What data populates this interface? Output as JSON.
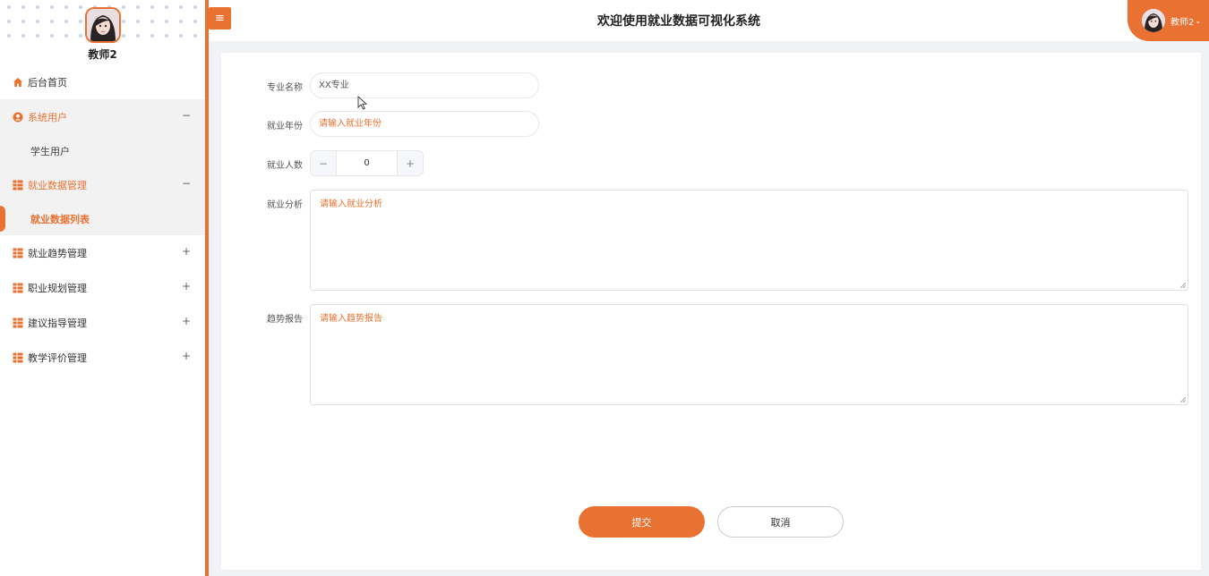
{
  "sidebar": {
    "user_name": "教师2",
    "items": [
      {
        "label": "后台首页",
        "icon": "home-icon"
      },
      {
        "label": "系统用户",
        "icon": "user-icon",
        "toggle": "−"
      },
      {
        "label": "学生用户"
      },
      {
        "label": "就业数据管理",
        "icon": "grid-icon",
        "toggle": "−"
      },
      {
        "label": "就业数据列表"
      },
      {
        "label": "就业趋势管理",
        "icon": "grid-icon",
        "toggle": "+"
      },
      {
        "label": "职业规划管理",
        "icon": "grid-icon",
        "toggle": "+"
      },
      {
        "label": "建议指导管理",
        "icon": "grid-icon",
        "toggle": "+"
      },
      {
        "label": "教学评价管理",
        "icon": "grid-icon",
        "toggle": "+"
      }
    ]
  },
  "header": {
    "menu_icon": "≡",
    "title": "欢迎使用就业数据可视化系统",
    "user_name": "教师2",
    "caret": "⌄"
  },
  "form": {
    "major": {
      "label": "专业名称",
      "value": "XX专业"
    },
    "year": {
      "label": "就业年份",
      "placeholder": "请输入就业年份"
    },
    "count": {
      "label": "就业人数",
      "value": "0",
      "minus": "−",
      "plus": "+"
    },
    "analysis": {
      "label": "就业分析",
      "placeholder": "请输入就业分析"
    },
    "report": {
      "label": "趋势报告",
      "placeholder": "请输入趋势报告"
    },
    "submit_label": "提交",
    "cancel_label": "取消"
  },
  "colors": {
    "accent": "#e97233"
  }
}
